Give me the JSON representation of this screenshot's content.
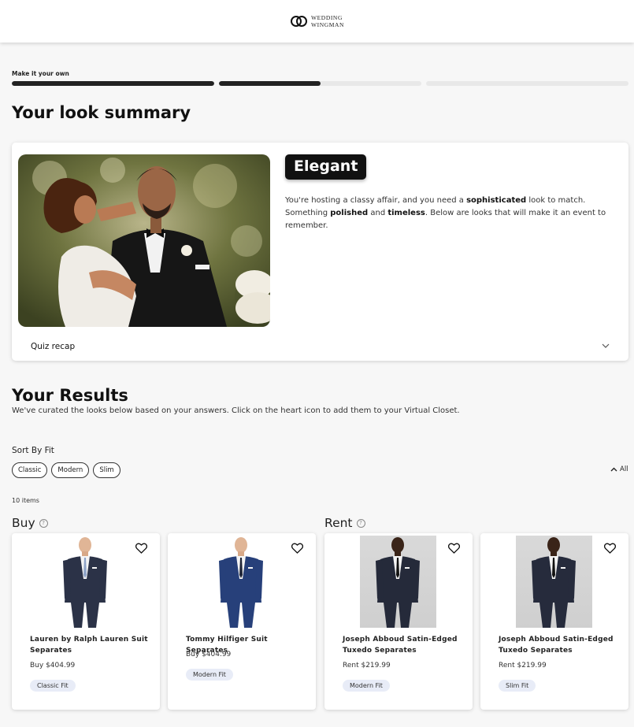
{
  "header": {
    "logo_line1": "WEDDING",
    "logo_line2": "WINGMAN"
  },
  "progress": {
    "label": "Make it your own",
    "segments": [
      1.0,
      0.5,
      0.0
    ]
  },
  "summary": {
    "title": "Your look summary",
    "style_name": "Elegant",
    "description_parts": [
      {
        "text": "You're hosting a classy affair, and you need a ",
        "bold": false
      },
      {
        "text": "sophisticated",
        "bold": true
      },
      {
        "text": " look to match. Something ",
        "bold": false
      },
      {
        "text": "polished",
        "bold": true
      },
      {
        "text": " and ",
        "bold": false
      },
      {
        "text": "timeless",
        "bold": true
      },
      {
        "text": ". Below are looks that will make it an event to remember.",
        "bold": false
      }
    ],
    "recap_label": "Quiz recap"
  },
  "results": {
    "title": "Your Results",
    "subtitle": "We've curated the looks below based on your answers. Click on the heart icon to add them to your Virtual Closet.",
    "sort_label": "Sort By Fit",
    "chips": [
      "Classic",
      "Modern",
      "Slim"
    ],
    "all_label": "All",
    "item_count": "10 items",
    "buy_label": "Buy",
    "rent_label": "Rent",
    "help_glyph": "?"
  },
  "products": [
    {
      "name": "Lauren by Ralph Lauren Suit Separates",
      "price": "Buy $404.99",
      "fit": "Classic Fit",
      "type": "buy",
      "suit_color": "#2b3247",
      "tie_color": "#8ea3c7"
    },
    {
      "name": "Tommy Hilfiger Suit Separates",
      "price": "Buy $404.99",
      "fit": "Modern Fit",
      "type": "buy",
      "suit_color": "#27407a",
      "tie_color": "#1e2436"
    },
    {
      "name": "Joseph Abboud Satin-Edged Tuxedo Separates",
      "price": "Rent $219.99",
      "fit": "Modern Fit",
      "type": "rent",
      "suit_color": "#252a3a",
      "tie_color": "#111111"
    },
    {
      "name": "Joseph Abboud Satin-Edged Tuxedo Separates",
      "price": "Rent $219.99",
      "fit": "Slim Fit",
      "type": "rent",
      "suit_color": "#262b3c",
      "tie_color": "#111111"
    }
  ],
  "colors": {
    "accent": "#111111",
    "fit_badge_bg": "#e8ecf7",
    "page_bg": "#f7f7f7"
  },
  "icons": {
    "logo": "wedding-rings-icon",
    "chevron": "chevron-down-icon",
    "collapse": "chevron-up-icon",
    "favorite": "heart-icon",
    "help": "help-circle-icon"
  }
}
